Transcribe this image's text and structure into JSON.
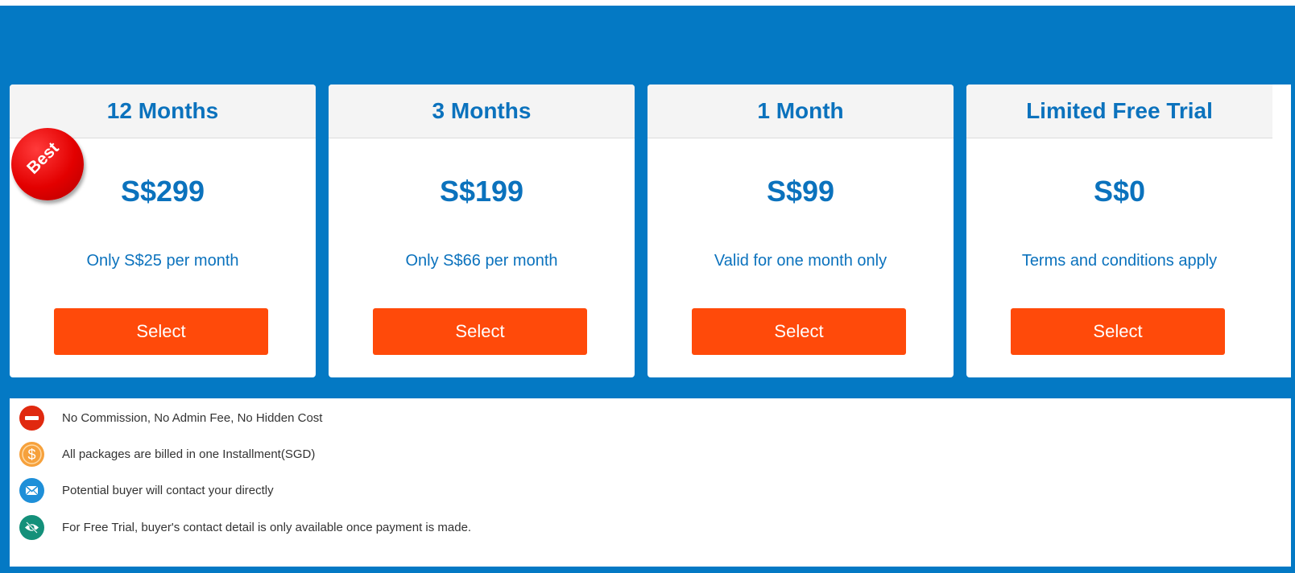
{
  "plans": [
    {
      "title": "12 Months",
      "price": "S$299",
      "description": "Only S$25 per month",
      "button": "Select"
    },
    {
      "title": "3 Months",
      "price": "S$199",
      "description": "Only S$66 per month",
      "button": "Select"
    },
    {
      "title": "1 Month",
      "price": "S$99",
      "description": "Valid for one month only",
      "button": "Select"
    },
    {
      "title": "Limited Free Trial",
      "price": "S$0",
      "description": "Terms and conditions apply",
      "button": "Select"
    }
  ],
  "badge": {
    "label": "Best"
  },
  "features": [
    {
      "icon": "no-entry-icon",
      "text": "No Commission, No Admin Fee, No Hidden Cost"
    },
    {
      "icon": "dollar-icon",
      "text": "All packages are billed in one Installment(SGD)"
    },
    {
      "icon": "envelope-icon",
      "text": "Potential buyer will contact your directly"
    },
    {
      "icon": "eye-slash-icon",
      "text": "For Free Trial, buyer's contact detail is only available once payment is made."
    }
  ],
  "colors": {
    "brand_blue": "#0479c4",
    "text_blue": "#0b72bd",
    "button_orange": "#ff4a0a",
    "badge_red": "#e30000",
    "no_entry_red": "#e0290f",
    "dollar_orange": "#f6a13c",
    "envelope_blue": "#1e8fd8",
    "eye_teal": "#14907a"
  }
}
